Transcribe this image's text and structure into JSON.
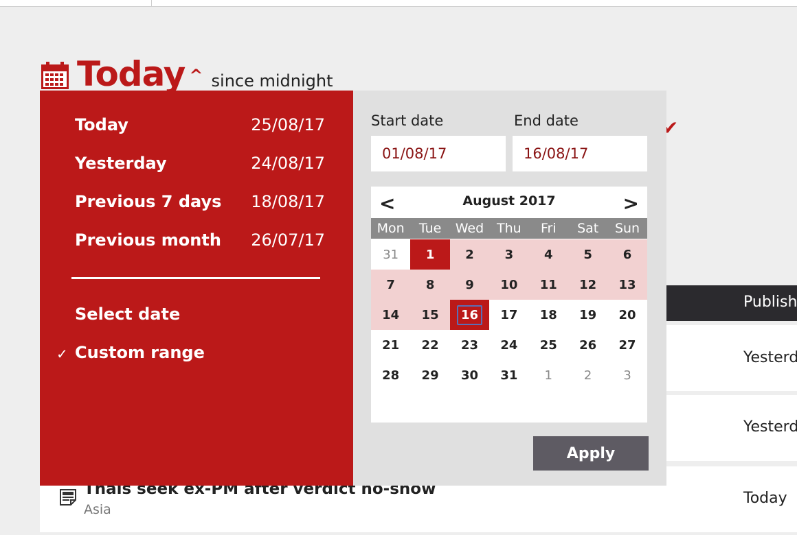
{
  "header": {
    "title": "Today",
    "caret": "^",
    "subtitle": "since midnight"
  },
  "background": {
    "table_header": "Publish",
    "rows": [
      "Yesterd",
      "Yesterd",
      "Today"
    ],
    "article": {
      "title": "Thais seek ex-PM after verdict no-show",
      "section": "Asia"
    }
  },
  "dropdown": {
    "presets": [
      {
        "label": "Today",
        "date": "25/08/17"
      },
      {
        "label": "Yesterday",
        "date": "24/08/17"
      },
      {
        "label": "Previous 7 days",
        "date": "18/08/17"
      },
      {
        "label": "Previous month",
        "date": "26/07/17"
      }
    ],
    "options": {
      "select_date": "Select date",
      "custom_range": "Custom range",
      "check": "✓"
    },
    "start_label": "Start date",
    "end_label": "End date",
    "start_value": "01/08/17",
    "end_value": "16/08/17",
    "calendar": {
      "month": "August 2017",
      "prev": "<",
      "next": ">",
      "weekdays": [
        "Mon",
        "Tue",
        "Wed",
        "Thu",
        "Fri",
        "Sat",
        "Sun"
      ],
      "weeks": [
        [
          "31",
          "1",
          "2",
          "3",
          "4",
          "5",
          "6"
        ],
        [
          "7",
          "8",
          "9",
          "10",
          "11",
          "12",
          "13"
        ],
        [
          "14",
          "15",
          "16",
          "17",
          "18",
          "19",
          "20"
        ],
        [
          "21",
          "22",
          "23",
          "24",
          "25",
          "26",
          "27"
        ],
        [
          "28",
          "29",
          "30",
          "31",
          "1",
          "2",
          "3"
        ]
      ]
    },
    "apply_label": "Apply"
  },
  "colors": {
    "brand_red": "#bb1919",
    "range_highlight": "#f2d1d1",
    "panel_gray": "#e0e0e0",
    "apply_button": "#5e5b63",
    "focus_outline": "#5a6fb8"
  }
}
